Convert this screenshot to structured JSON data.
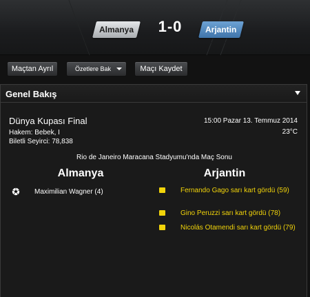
{
  "header": {
    "home_team": "Almanya",
    "away_team": "Arjantin",
    "score": "1-0",
    "home_color": "#c9cccf",
    "away_color": "#4f86bf"
  },
  "toolbar": {
    "leave_label": "Maçtan Ayrıl",
    "summary_label": "Özetlere Bak",
    "save_label": "Maçı Kaydet"
  },
  "panel": {
    "title": "Genel Bakış",
    "match_title": "Dünya Kupası Final",
    "referee": "Hakem: Bebek, I",
    "attendance": "Biletli Seyirci: 78,838",
    "datetime": "15:00 Pazar 13. Temmuz 2014",
    "temperature": "23°C",
    "venue": "Rio de Janeiro Maracana Stadyumu'nda Maç Sonu",
    "home_heading": "Almanya",
    "away_heading": "Arjantin",
    "home_events": [
      {
        "text": "Maximilian Wagner (4)",
        "icon": "football-icon"
      }
    ],
    "away_events": [
      {
        "text": "Fernando Gago sarı kart gördü (59)",
        "icon": "yellow-card-icon"
      },
      {
        "text": "Gino Peruzzi sarı kart gördü (78)",
        "icon": "yellow-card-icon"
      },
      {
        "text": "Nicolás Otamendi sarı kart gördü (79)",
        "icon": "yellow-card-icon"
      }
    ],
    "card_color": "#f2d40a"
  }
}
